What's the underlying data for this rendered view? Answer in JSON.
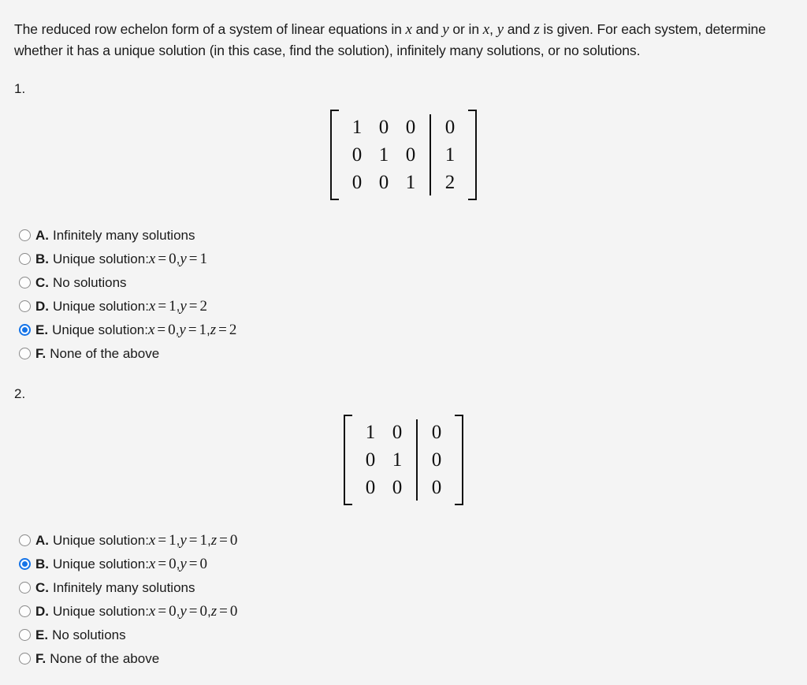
{
  "prompt": {
    "part1": "The reduced row echelon form of a system of linear equations in ",
    "v1": "x",
    "part2": " and ",
    "v2": "y",
    "part3": " or in ",
    "v3": "x",
    "part4": ", ",
    "v4": "y",
    "part5": " and ",
    "v5": "z",
    "part6": " is given. For each system, determine whether it has a unique solution (in this case, find the solution), infinitely many solutions, or no solutions."
  },
  "questions": [
    {
      "number": "1.",
      "matrix": {
        "coefficients": [
          [
            "1",
            "0",
            "0"
          ],
          [
            "0",
            "1",
            "0"
          ],
          [
            "0",
            "0",
            "1"
          ]
        ],
        "augmented": [
          "0",
          "1",
          "2"
        ],
        "rows": 3,
        "cols": 3
      },
      "options": [
        {
          "letter": "A.",
          "text": "Infinitely many solutions",
          "selected": false,
          "math": []
        },
        {
          "letter": "B.",
          "text": "Unique solution: ",
          "selected": false,
          "math": [
            {
              "var": "x",
              "eq": "=",
              "val": "0"
            },
            {
              "var": "y",
              "eq": "=",
              "val": "1"
            }
          ]
        },
        {
          "letter": "C.",
          "text": "No solutions",
          "selected": false,
          "math": []
        },
        {
          "letter": "D.",
          "text": "Unique solution: ",
          "selected": false,
          "math": [
            {
              "var": "x",
              "eq": "=",
              "val": "1"
            },
            {
              "var": "y",
              "eq": "=",
              "val": "2"
            }
          ]
        },
        {
          "letter": "E.",
          "text": "Unique solution: ",
          "selected": true,
          "math": [
            {
              "var": "x",
              "eq": "=",
              "val": "0"
            },
            {
              "var": "y",
              "eq": "=",
              "val": "1"
            },
            {
              "var": "z",
              "eq": "=",
              "val": "2"
            }
          ]
        },
        {
          "letter": "F.",
          "text": "None of the above",
          "selected": false,
          "math": []
        }
      ]
    },
    {
      "number": "2.",
      "matrix": {
        "coefficients": [
          [
            "1",
            "0"
          ],
          [
            "0",
            "1"
          ],
          [
            "0",
            "0"
          ]
        ],
        "augmented": [
          "0",
          "0",
          "0"
        ],
        "rows": 3,
        "cols": 2
      },
      "options": [
        {
          "letter": "A.",
          "text": "Unique solution: ",
          "selected": false,
          "math": [
            {
              "var": "x",
              "eq": "=",
              "val": "1"
            },
            {
              "var": "y",
              "eq": "=",
              "val": "1"
            },
            {
              "var": "z",
              "eq": "=",
              "val": "0"
            }
          ]
        },
        {
          "letter": "B.",
          "text": "Unique solution: ",
          "selected": true,
          "math": [
            {
              "var": "x",
              "eq": "=",
              "val": "0"
            },
            {
              "var": "y",
              "eq": "=",
              "val": "0"
            }
          ]
        },
        {
          "letter": "C.",
          "text": "Infinitely many solutions",
          "selected": false,
          "math": []
        },
        {
          "letter": "D.",
          "text": "Unique solution: ",
          "selected": false,
          "math": [
            {
              "var": "x",
              "eq": "=",
              "val": "0"
            },
            {
              "var": "y",
              "eq": "=",
              "val": "0"
            },
            {
              "var": "z",
              "eq": "=",
              "val": "0"
            }
          ]
        },
        {
          "letter": "E.",
          "text": "No solutions",
          "selected": false,
          "math": []
        },
        {
          "letter": "F.",
          "text": "None of the above",
          "selected": false,
          "math": []
        }
      ]
    }
  ],
  "colors": {
    "background": "#f4f4f4",
    "text": "#1a1a1a",
    "accent_selected": "#1574e8",
    "radio_border": "#8a8a8a"
  }
}
